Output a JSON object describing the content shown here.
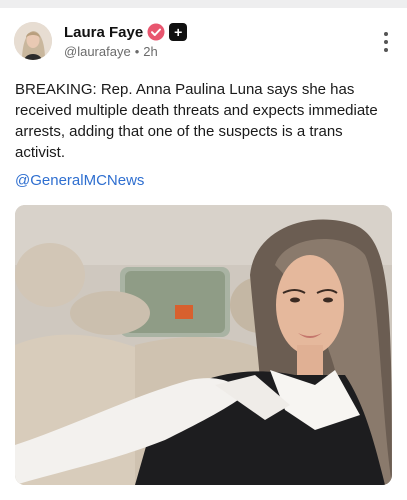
{
  "post": {
    "author_name": "Laura Faye",
    "handle": "@laurafaye",
    "separator": "•",
    "time": "2h",
    "text": "BREAKING: Rep. Anna Paulina Luna says she has received multiple death threats and expects immediate arrests, adding that one of the suspects is a trans activist.",
    "mention": "@GeneralMCNews",
    "plus_badge": "+"
  },
  "icons": {
    "verified": "verified-badge-icon",
    "menu": "more-vertical-icon"
  },
  "colors": {
    "verified": "#e8566f",
    "mention": "#2f6fd0"
  }
}
